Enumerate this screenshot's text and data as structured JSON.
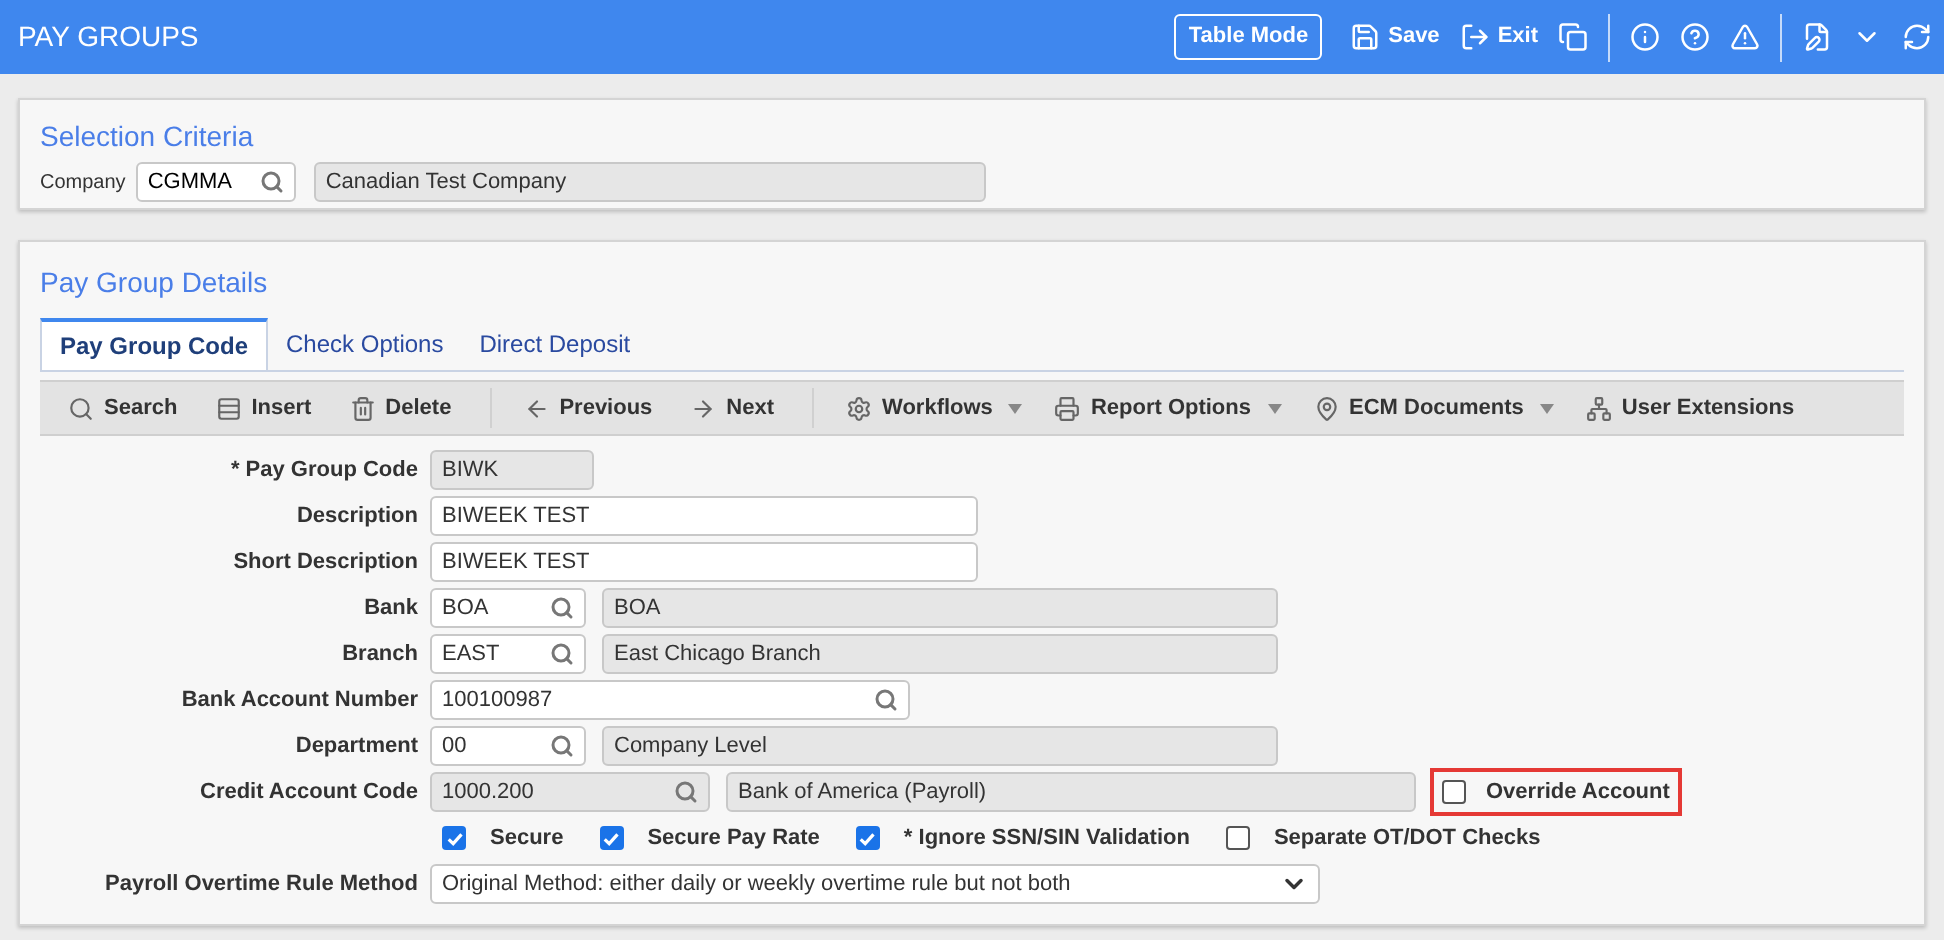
{
  "header": {
    "title": "PAY GROUPS",
    "mode_button": "Table Mode",
    "actions": [
      {
        "kind": "save",
        "label": "Save"
      },
      {
        "kind": "exit",
        "label": "Exit"
      },
      {
        "kind": "copy"
      },
      {
        "kind": "divider"
      },
      {
        "kind": "info"
      },
      {
        "kind": "help"
      },
      {
        "kind": "warning"
      },
      {
        "kind": "divider"
      },
      {
        "kind": "edit"
      },
      {
        "kind": "caret"
      },
      {
        "kind": "refresh"
      }
    ]
  },
  "selection_criteria": {
    "title": "Selection Criteria",
    "company": {
      "label": "Company",
      "value": "CGMMA",
      "description": "Canadian Test Company"
    }
  },
  "details": {
    "title": "Pay Group Details",
    "tabs": [
      {
        "label": "Pay Group Code",
        "selected": true
      },
      {
        "label": "Check Options",
        "selected": false
      },
      {
        "label": "Direct Deposit",
        "selected": false
      }
    ],
    "toolbar": [
      {
        "kind": "search",
        "label": "Search"
      },
      {
        "kind": "insert",
        "label": "Insert"
      },
      {
        "kind": "delete",
        "label": "Delete"
      },
      {
        "kind": "separator"
      },
      {
        "kind": "previous",
        "label": "Previous"
      },
      {
        "kind": "next",
        "label": "Next"
      },
      {
        "kind": "separator"
      },
      {
        "kind": "workflows",
        "label": "Workflows",
        "dropdown": true
      },
      {
        "kind": "report",
        "label": "Report Options",
        "dropdown": true
      },
      {
        "kind": "ecm",
        "label": "ECM Documents",
        "dropdown": true
      },
      {
        "kind": "extensions",
        "label": "User Extensions",
        "dropdown": false
      }
    ],
    "rows": [
      {
        "kind": "field",
        "label": "* Pay Group Code",
        "value": "BIWK",
        "readonly": true,
        "lookup": false
      },
      {
        "kind": "field",
        "label": "Description",
        "value": "BIWEEK TEST",
        "readonly": false,
        "lookup": false
      },
      {
        "kind": "field",
        "label": "Short Description",
        "value": "BIWEEK TEST",
        "readonly": false,
        "lookup": false
      },
      {
        "kind": "field",
        "label": "Bank",
        "value": "BOA",
        "readonly": false,
        "lookup": true,
        "description": "BOA"
      },
      {
        "kind": "field",
        "label": "Branch",
        "value": "EAST",
        "readonly": false,
        "lookup": true,
        "description": "East Chicago Branch"
      },
      {
        "kind": "field",
        "label": "Bank Account Number",
        "value": "100100987",
        "readonly": false,
        "lookup": true
      },
      {
        "kind": "field",
        "label": "Department",
        "value": "00",
        "readonly": false,
        "lookup": true,
        "description": "Company Level"
      },
      {
        "kind": "field",
        "label": "Credit Account Code",
        "value": "1000.200",
        "readonly": true,
        "lookup": true,
        "description": "Bank of America (Payroll)",
        "checkbox": {
          "label": "Override Account",
          "checked": false,
          "highlighted": true
        }
      },
      {
        "kind": "checkboxes",
        "items": [
          {
            "label": "Secure",
            "checked": true
          },
          {
            "label": "Secure Pay Rate",
            "checked": true
          },
          {
            "label": "* Ignore SSN/SIN Validation",
            "checked": true
          },
          {
            "label": "Separate OT/DOT Checks",
            "checked": false
          }
        ]
      },
      {
        "kind": "select",
        "label": "Payroll Overtime Rule Method",
        "value": "Original Method: either daily or weekly overtime rule but not both"
      }
    ]
  }
}
